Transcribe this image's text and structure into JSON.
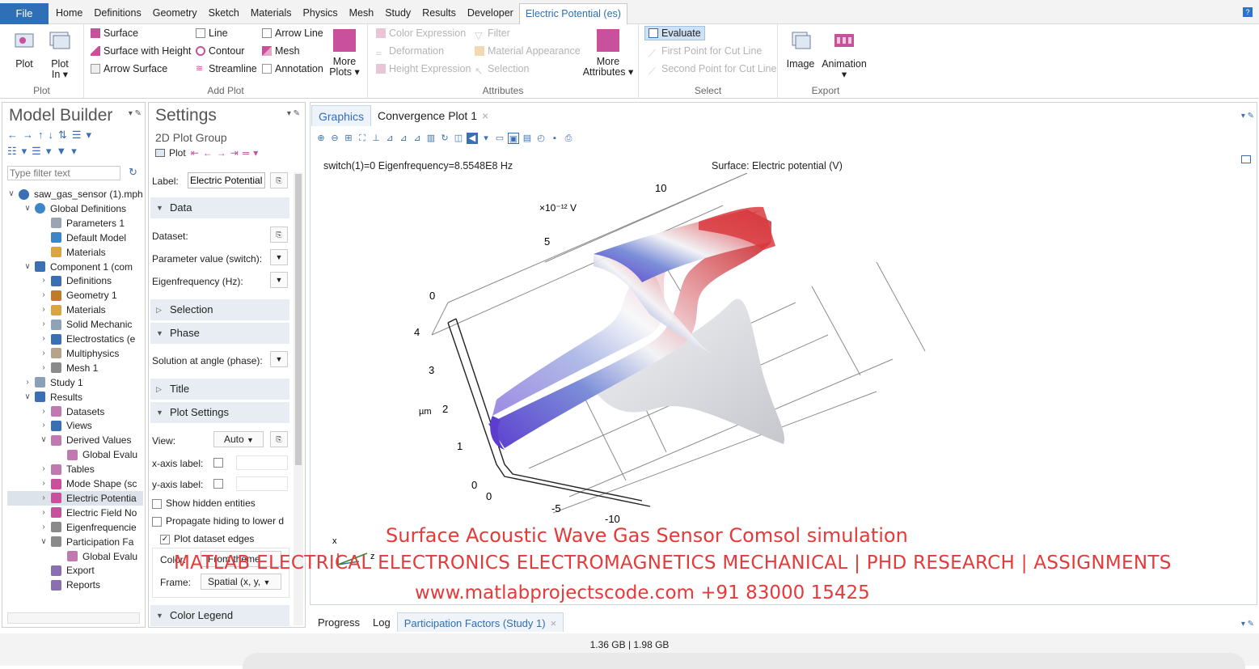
{
  "menubar": {
    "file": "File",
    "tabs": [
      "Home",
      "Definitions",
      "Geometry",
      "Sketch",
      "Materials",
      "Physics",
      "Mesh",
      "Study",
      "Results",
      "Developer",
      "Electric Potential (es)"
    ],
    "help": "?"
  },
  "ribbon": {
    "plot_group": {
      "label": "Plot",
      "plot": "Plot",
      "plot_in_1": "Plot",
      "plot_in_2": "In ▾"
    },
    "add_plot": {
      "label": "Add Plot",
      "surface": "Surface",
      "surface_height": "Surface with Height",
      "arrow_surface": "Arrow Surface",
      "line": "Line",
      "contour": "Contour",
      "streamline": "Streamline",
      "arrow_line": "Arrow Line",
      "mesh": "Mesh",
      "annotation": "Annotation",
      "more_plots_1": "More",
      "more_plots_2": "Plots ▾"
    },
    "attributes": {
      "label": "Attributes",
      "color_expression": "Color Expression",
      "deformation": "Deformation",
      "height_expression": "Height Expression",
      "filter": "Filter",
      "material_appearance": "Material Appearance",
      "selection": "Selection",
      "more_attr_1": "More",
      "more_attr_2": "Attributes ▾"
    },
    "select": {
      "label": "Select",
      "evaluate": "Evaluate",
      "first_point": "First Point for Cut Line",
      "second_point": "Second Point for Cut Line"
    },
    "export": {
      "label": "Export",
      "image": "Image",
      "animation": "Animation",
      "animation_arrow": "▾"
    }
  },
  "model_builder": {
    "title": "Model Builder",
    "filter_placeholder": "Type filter text",
    "tree": [
      {
        "label": "saw_gas_sensor (1).mph",
        "depth": 0,
        "tw": "∨"
      },
      {
        "label": "Global Definitions",
        "depth": 1,
        "tw": "∨"
      },
      {
        "label": "Parameters 1",
        "depth": 2,
        "tw": ""
      },
      {
        "label": "Default Model",
        "depth": 2,
        "tw": ""
      },
      {
        "label": "Materials",
        "depth": 2,
        "tw": ""
      },
      {
        "label": "Component 1 (com",
        "depth": 1,
        "tw": "∨"
      },
      {
        "label": "Definitions",
        "depth": 2,
        "tw": "›"
      },
      {
        "label": "Geometry 1",
        "depth": 2,
        "tw": "›"
      },
      {
        "label": "Materials",
        "depth": 2,
        "tw": "›"
      },
      {
        "label": "Solid Mechanic",
        "depth": 2,
        "tw": "›"
      },
      {
        "label": "Electrostatics (e",
        "depth": 2,
        "tw": "›"
      },
      {
        "label": "Multiphysics",
        "depth": 2,
        "tw": "›"
      },
      {
        "label": "Mesh 1",
        "depth": 2,
        "tw": "›"
      },
      {
        "label": "Study 1",
        "depth": 1,
        "tw": "›"
      },
      {
        "label": "Results",
        "depth": 1,
        "tw": "∨"
      },
      {
        "label": "Datasets",
        "depth": 2,
        "tw": "›"
      },
      {
        "label": "Views",
        "depth": 2,
        "tw": "›"
      },
      {
        "label": "Derived Values",
        "depth": 2,
        "tw": "∨"
      },
      {
        "label": "Global Evalu",
        "depth": 3,
        "tw": ""
      },
      {
        "label": "Tables",
        "depth": 2,
        "tw": "›"
      },
      {
        "label": "Mode Shape (sc",
        "depth": 2,
        "tw": "›"
      },
      {
        "label": "Electric Potentia",
        "depth": 2,
        "tw": "›",
        "selected": true
      },
      {
        "label": "Electric Field No",
        "depth": 2,
        "tw": "›"
      },
      {
        "label": "Eigenfrequencie",
        "depth": 2,
        "tw": "›"
      },
      {
        "label": "Participation Fa",
        "depth": 2,
        "tw": "∨"
      },
      {
        "label": "Global Evalu",
        "depth": 3,
        "tw": ""
      },
      {
        "label": "Export",
        "depth": 2,
        "tw": ""
      },
      {
        "label": "Reports",
        "depth": 2,
        "tw": ""
      }
    ]
  },
  "settings": {
    "title": "Settings",
    "subtitle": "2D Plot Group",
    "plot_btn": "Plot",
    "label_caption": "Label:",
    "label_value": "Electric Potential",
    "sections": {
      "data": "Data",
      "selection": "Selection",
      "phase": "Phase",
      "title": "Title",
      "plot_settings": "Plot Settings",
      "color_legend": "Color Legend"
    },
    "dataset": "Dataset:",
    "param_value": "Parameter value (switch):",
    "eigenfreq": "Eigenfrequency (Hz):",
    "solution_angle": "Solution at angle (phase):",
    "view": "View:",
    "view_value": "Auto",
    "xaxis": "x-axis label:",
    "yaxis": "y-axis label:",
    "show_hidden": "Show hidden entities",
    "propagate": "Propagate hiding to lower d",
    "plot_edges": "Plot dataset edges",
    "color": "Color:",
    "color_value": "From theme",
    "frame": "Frame:",
    "frame_value": "Spatial  (x, y,"
  },
  "graphics": {
    "tabs": [
      "Graphics",
      "Convergence Plot 1"
    ],
    "header_left": "switch(1)=0 Eigenfrequency=8.5548E8 Hz",
    "header_right": "Surface: Electric potential (V)",
    "zscale": "×10⁻¹² V",
    "zticks": [
      "10",
      "5",
      "0"
    ],
    "yticks": [
      "4",
      "3",
      "2",
      "1",
      "0"
    ],
    "yunit": "µm",
    "xticks": [
      "0",
      "-5",
      "-10"
    ],
    "axis_x": "x",
    "axis_z": "z"
  },
  "overlay": {
    "line1": "Surface Acoustic Wave Gas Sensor Comsol simulation",
    "line2": "MATLAB ELECTRICAL ELECTRONICS ELECTROMAGNETICS MECHANICAL | PHD RESEARCH | ASSIGNMENTS",
    "line3": "www.matlabprojectscode.com +91 83000 15425"
  },
  "bottom_tabs": [
    "Progress",
    "Log",
    "Participation Factors (Study 1)"
  ],
  "status": "1.36 GB | 1.98 GB",
  "colors": {
    "accent": "#2e6fb5",
    "overlay": "#e53a3a",
    "plot_icon": "#c9509a"
  }
}
